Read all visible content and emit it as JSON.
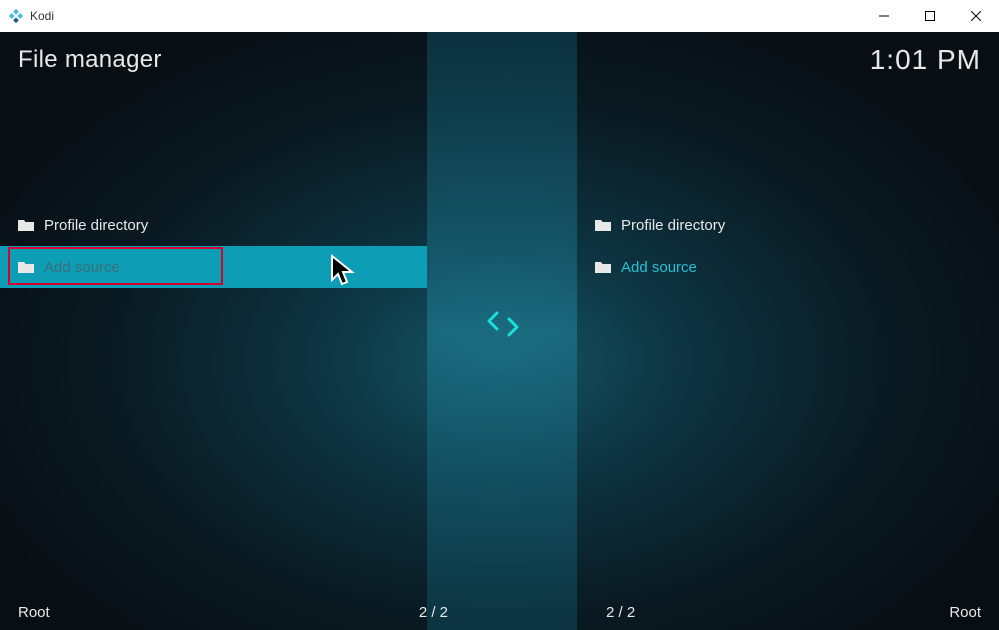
{
  "window": {
    "title": "Kodi"
  },
  "header": {
    "title": "File manager",
    "clock": "1:01 PM"
  },
  "panes": {
    "left": {
      "items": [
        {
          "label": "Profile directory",
          "style": "normal"
        },
        {
          "label": "Add source",
          "style": "selected"
        }
      ],
      "footer_label": "Root",
      "footer_count": "2 / 2"
    },
    "right": {
      "items": [
        {
          "label": "Profile directory",
          "style": "normal"
        },
        {
          "label": "Add source",
          "style": "accent"
        }
      ],
      "footer_label": "Root",
      "footer_count": "2 / 2"
    }
  }
}
